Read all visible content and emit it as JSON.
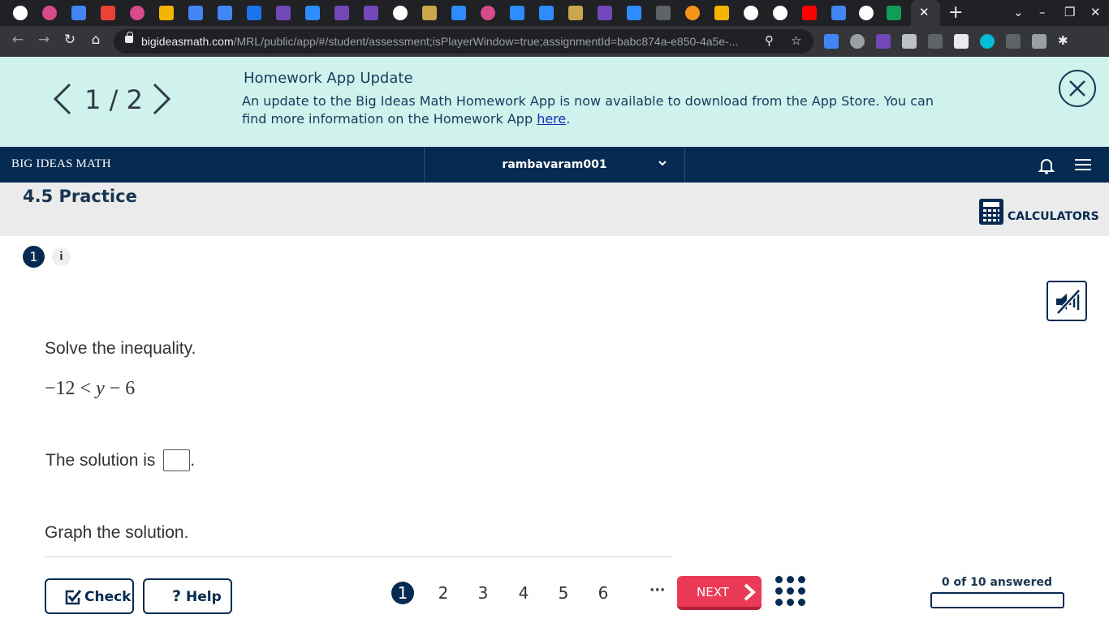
{
  "browser": {
    "tabs": [
      {
        "icon": "google-icon",
        "color": "#ffffff"
      },
      {
        "icon": "pinwheel-icon",
        "color": "#d84a8a"
      },
      {
        "icon": "docs-icon",
        "color": "#4285f4"
      },
      {
        "icon": "gmail-icon",
        "color": "#ea4335"
      },
      {
        "icon": "pinwheel-icon",
        "color": "#d84a8a"
      },
      {
        "icon": "classroom-icon",
        "color": "#f4b400"
      },
      {
        "icon": "docs-icon",
        "color": "#4285f4"
      },
      {
        "icon": "docs-icon",
        "color": "#4285f4"
      },
      {
        "icon": "sheet-icon",
        "color": "#1a73e8"
      },
      {
        "icon": "forms-icon",
        "color": "#7248b9"
      },
      {
        "icon": "zoom-icon",
        "color": "#2d8cff"
      },
      {
        "icon": "forms-icon",
        "color": "#7248b9"
      },
      {
        "icon": "forms-icon",
        "color": "#7248b9"
      },
      {
        "icon": "globe-icon",
        "color": "#ffffff"
      },
      {
        "icon": "bottle-icon",
        "color": "#c9a74a"
      },
      {
        "icon": "zoom-icon",
        "color": "#2d8cff"
      },
      {
        "icon": "pinwheel-icon",
        "color": "#d84a8a"
      },
      {
        "icon": "zoom-icon",
        "color": "#2d8cff"
      },
      {
        "icon": "zoom-icon",
        "color": "#2d8cff"
      },
      {
        "icon": "bottle-icon",
        "color": "#c9a74a"
      },
      {
        "icon": "forms-icon",
        "color": "#7248b9"
      },
      {
        "icon": "zoom-icon",
        "color": "#2d8cff"
      },
      {
        "icon": "pdf-icon",
        "color": "#5f6368"
      },
      {
        "icon": "bitcoin-icon",
        "color": "#f7931a"
      },
      {
        "icon": "image-icon",
        "color": "#f4b400"
      },
      {
        "icon": "google-icon",
        "color": "#ffffff"
      },
      {
        "icon": "google-icon",
        "color": "#ffffff"
      },
      {
        "icon": "youtube-icon",
        "color": "#ff0000"
      },
      {
        "icon": "docs-icon",
        "color": "#4285f4"
      },
      {
        "icon": "google-icon",
        "color": "#ffffff"
      },
      {
        "icon": "drive-icon",
        "color": "#0f9d58"
      }
    ],
    "url_host": "bigideasmath.com",
    "url_path": "/MRL/public/app/#/student/assessment;isPlayerWindow=true;assignmentId=babc874a-e850-4a5e-..."
  },
  "banner": {
    "pager": "1 / 2",
    "title": "Homework App Update",
    "text": "An update to the Big Ideas Math Homework App is now available to download from the App Store. You can find more information on the Homework App ",
    "link": "here",
    "text_end": "."
  },
  "header": {
    "brand": "BIG IDEAS MATH",
    "username": "rambavaram001"
  },
  "page": {
    "title": "4.5 Practice",
    "calculators_label": "CALCULATORS"
  },
  "question": {
    "number": "1",
    "info": "i",
    "prompt": "Solve the inequality.",
    "math_lhs": "−12 < ",
    "math_var": "y",
    "math_rhs": " − 6",
    "solution_prefix": "The solution is",
    "solution_suffix": ".",
    "answer_value": "",
    "graph_prompt": "Graph the solution."
  },
  "footer": {
    "check_label": "Check",
    "help_label": "Help",
    "question_links": [
      "1",
      "2",
      "3",
      "4",
      "5",
      "6"
    ],
    "active_question": "1",
    "more_label": "···",
    "next_label": "NEXT",
    "progress_label": "0 of 10 answered",
    "progress_fraction": 0
  },
  "colors": {
    "navy": "#062b52",
    "banner_bg": "#cff3ec",
    "next_red": "#ea3a56"
  }
}
